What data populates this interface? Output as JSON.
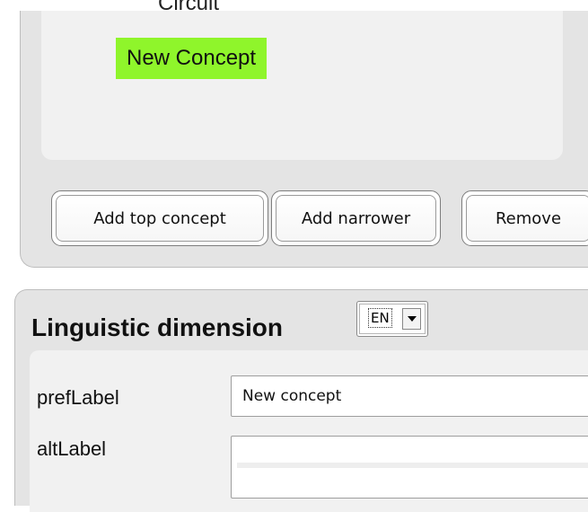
{
  "tree": {
    "cut_node_text": "Circuit",
    "selected_node": "New Concept"
  },
  "buttons": {
    "add_top_concept": "Add top concept",
    "add_narrower": "Add narrower",
    "remove": "Remove"
  },
  "linguistic": {
    "title": "Linguistic dimension",
    "language": "EN",
    "fields": {
      "pref_label": "prefLabel",
      "pref_value": "New concept",
      "alt_label": "altLabel",
      "alt_value": ""
    }
  },
  "colors": {
    "selected_highlight": "#8ff52b",
    "panel_bg": "#e4e4e4",
    "inner_bg": "#f1f1f1"
  }
}
